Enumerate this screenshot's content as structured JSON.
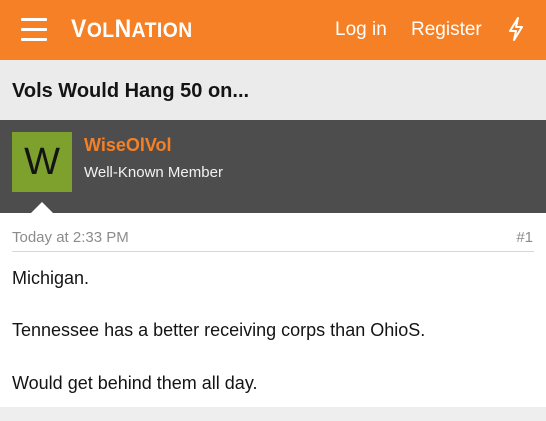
{
  "header": {
    "logo": {
      "part1": "V",
      "part2": "OL",
      "part3": "N",
      "part4": "ATION"
    },
    "login_label": "Log in",
    "register_label": "Register",
    "background_color": "#f68025",
    "menu_icon": "hamburger-menu-icon",
    "whats_new_icon": "lightning-bolt-icon"
  },
  "thread": {
    "title": "Vols Would Hang 50 on..."
  },
  "post": {
    "avatar_letter": "W",
    "avatar_color": "#7ea12e",
    "username": "WiseOlVol",
    "user_title": "Well-Known Member",
    "date": "Today at 2:33 PM",
    "number": "#1",
    "lines": [
      "Michigan.",
      "Tennessee has a better receiving corps than OhioS.",
      "Would get behind them all day."
    ]
  }
}
